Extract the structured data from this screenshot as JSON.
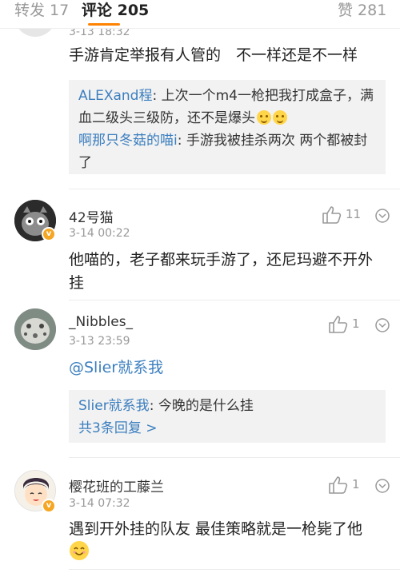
{
  "tabs": {
    "repost": "转发 17",
    "comments": "评论 205",
    "likes": "赞 281"
  },
  "comments": [
    {
      "time": "3-13 18:32",
      "text": "手游肯定举报有人管的　不一样还是不一样",
      "replies": [
        {
          "name": "ALEXand程",
          "text": ": 上次一个m4一枪把我打成盒子，满血二级头三级防，还不是爆头"
        },
        {
          "name": "啊那只冬菇的喵i",
          "text": ": 手游我被挂杀两次 两个都被封了"
        }
      ]
    },
    {
      "name": "42号猫",
      "time": "3-14 00:22",
      "likes": "11",
      "text": "他喵的，老子都来玩手游了，还尼玛避不开外挂"
    },
    {
      "name": "_Nibbles_",
      "time": "3-13 23:59",
      "likes": "1",
      "mention": "@Slier就系我",
      "reply": {
        "name": "Slier就系我",
        "text": ": 今晚的是什么挂"
      },
      "view_replies": "共3条回复 >"
    },
    {
      "name": "樱花班的工藤兰",
      "time": "3-14 07:32",
      "likes": "1",
      "text": "遇到开外挂的队友 最佳策略就是一枪毙了他"
    }
  ],
  "colors": {
    "accent": "#ff8200",
    "link": "#3b7ebf",
    "vip_badge": "#f5a623"
  },
  "icons": [
    "like-icon",
    "more-icon",
    "vip-badge-icon",
    "smile-emoji-icon",
    "laugh-cry-emoji-icon"
  ]
}
